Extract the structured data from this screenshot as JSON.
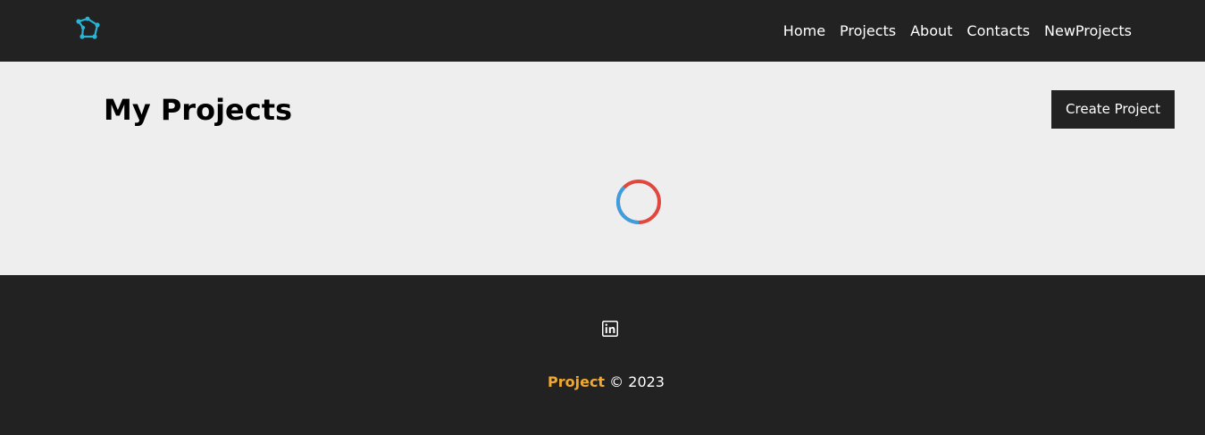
{
  "header": {
    "logo_icon": "network-polygon-logo-icon",
    "nav": [
      {
        "label": "Home"
      },
      {
        "label": "Projects"
      },
      {
        "label": "About"
      },
      {
        "label": "Contacts"
      },
      {
        "label": "NewProjects"
      }
    ]
  },
  "main": {
    "title": "My Projects",
    "create_button_label": "Create Project",
    "spinner_icon": "loading-spinner-icon"
  },
  "footer": {
    "social_icon": "linkedin-icon",
    "brand": "Project",
    "copyright_text": "© 2023"
  },
  "colors": {
    "header_bg": "#222222",
    "main_bg": "#eeeeee",
    "logo_accent": "#29b6d6",
    "brand_accent": "#f0a830",
    "spinner_red": "#e0483e",
    "spinner_blue": "#3a9ee0"
  }
}
